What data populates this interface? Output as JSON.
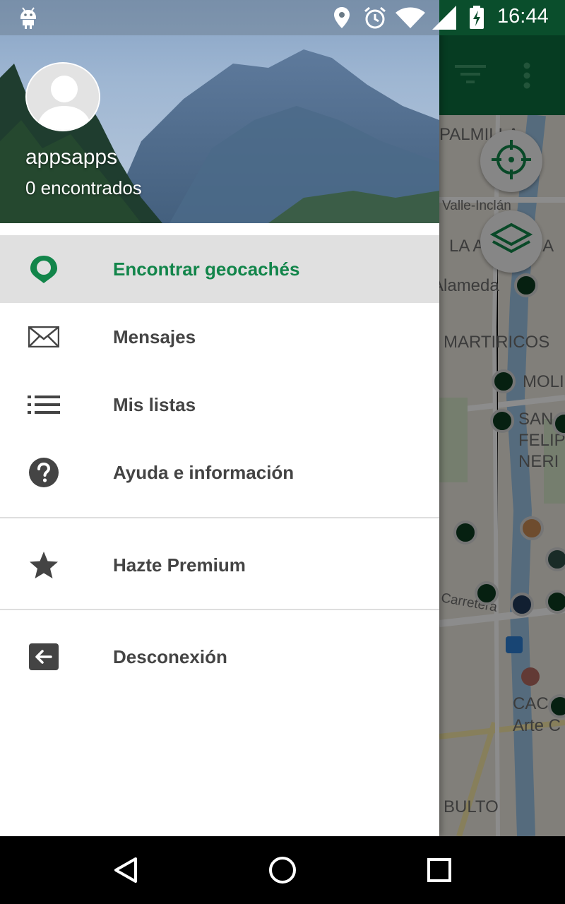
{
  "status_bar": {
    "time": "16:44",
    "icons": [
      "android-notification-icon",
      "location-pin-icon",
      "alarm-icon",
      "wifi-icon",
      "cell-signal-icon",
      "battery-charging-icon"
    ]
  },
  "drawer": {
    "user": {
      "name": "appsapps",
      "found": "0 encontrados"
    },
    "menu": [
      {
        "label": "Encontrar geocachés",
        "icon": "map-marker-icon",
        "active": true
      },
      {
        "label": "Mensajes",
        "icon": "envelope-icon"
      },
      {
        "label": "Mis listas",
        "icon": "list-icon"
      },
      {
        "label": "Ayuda e información",
        "icon": "help-icon"
      }
    ],
    "premium": {
      "label": "Hazte Premium",
      "icon": "star-icon"
    },
    "logout": {
      "label": "Desconexión",
      "icon": "logout-icon"
    }
  },
  "map": {
    "labels": [
      "PALMILLA",
      "Valle-Inclán",
      "LA ALAMEDA",
      "Alameda",
      "MARTIRICOS",
      "MOLINOS",
      "SAN FELIPE NERI",
      "Carretera",
      "CAC",
      "Arte C",
      "BULTO"
    ],
    "accent": "#12854a",
    "toolbar_color": "#0b6e3e"
  },
  "nav_bar": {
    "buttons": [
      "back-icon",
      "home-icon",
      "recents-icon"
    ]
  }
}
